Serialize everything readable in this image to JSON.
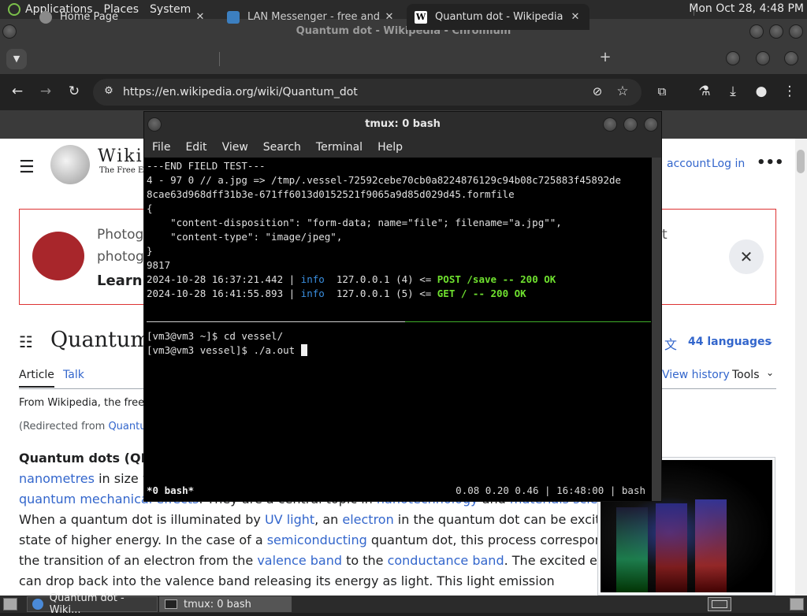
{
  "panel": {
    "menus": [
      "Applications",
      "Places",
      "System"
    ],
    "clock": "Mon Oct 28,  4:48 PM"
  },
  "chromium": {
    "window_title": "Quantum dot - Wikipedia - Chromium",
    "tabs": [
      {
        "label": "Home Page"
      },
      {
        "label": "LAN Messenger - free and op"
      },
      {
        "label": "Quantum dot - Wikipedia"
      }
    ],
    "url": "https://en.wikipedia.org/wiki/Quantum_dot"
  },
  "wiki": {
    "logo_word": "Wiki",
    "logo_tagline": "The Free En",
    "account_link": "account",
    "login_link": "Log in",
    "banner_line1": "Photogr",
    "banner_line2": "photogr",
    "banner_line3": "Learn",
    "banner_tail": "t",
    "title": "Quantum d",
    "languages": "44 languages",
    "tab_article": "Article",
    "tab_talk": "Talk",
    "view_history": "View history",
    "tools": "Tools",
    "from_wikipedia": "From Wikipedia, the free",
    "redirected_prefix": "(Redirected from ",
    "redirected_link": "Quantum",
    "p1_bold": "Quantum dots (QDs)",
    "p2_link": "nanometres",
    "p2_text": " in size wit",
    "p3_link": "quantum mechanical effects",
    "p3_text": ". They are a central topic in ",
    "p3_link2": "nanotechnology",
    "p3_text2": " and ",
    "p3_link3": "materials science",
    "p4_a": "When a quantum dot is illuminated by ",
    "p4_l1": "UV light",
    "p4_b": ", an ",
    "p4_l2": "electron",
    "p4_c": " in the quantum dot can be excited to a",
    "p5_a": "state of higher energy. In the case of a ",
    "p5_l1": "semiconducting",
    "p5_b": " quantum dot, this process corresponds to",
    "p6_a": "the transition of an electron from the ",
    "p6_l1": "valence band",
    "p6_b": " to the ",
    "p6_l2": "conductance band",
    "p6_c": ". The excited electron",
    "p7": "can drop back into the valence band releasing its energy as light. This light emission"
  },
  "terminal": {
    "title": "tmux: 0 bash",
    "menus": [
      "File",
      "Edit",
      "View",
      "Search",
      "Terminal",
      "Help"
    ],
    "line1": "---END FIELD TEST---",
    "line2": "4 - 97 0 // a.jpg => /tmp/.vessel-72592cebe70cb0a8224876129c94b08c725883f45892de",
    "line3": "8cae63d968dff31b3e-671ff6013d0152521f9065a9d85d029d45.formfile",
    "line4": "{",
    "line5": "    \"content-disposition\": \"form-data; name=\"file\"; filename=\"a.jpg\"\",",
    "line6": "    \"content-type\": \"image/jpeg\",",
    "line7": "}",
    "line8": "9817",
    "log1": {
      "ts": "2024-10-28 16:37:21.442 | ",
      "level": "info",
      "mid": "  127.0.0.1 (4) <= ",
      "req": "POST /save -- 200 OK"
    },
    "log2": {
      "ts": "2024-10-28 16:41:55.893 | ",
      "level": "info",
      "mid": "  127.0.0.1 (5) <= ",
      "req": "GET / -- 200 OK"
    },
    "prompt1": "[vm3@vm3 ~]$ cd vessel/",
    "prompt2": "[vm3@vm3 vessel]$ ./a.out ",
    "status_left": "*0 bash*",
    "status_right": "0.08 0.20 0.46 | 16:48:00 | bash"
  },
  "taskbar": {
    "items": [
      "Quantum dot - Wiki...",
      "tmux: 0 bash"
    ]
  },
  "colors": {
    "accent_link": "#3366cc",
    "terminal_info": "#3a8fe0",
    "terminal_ok": "#6fe12f"
  }
}
